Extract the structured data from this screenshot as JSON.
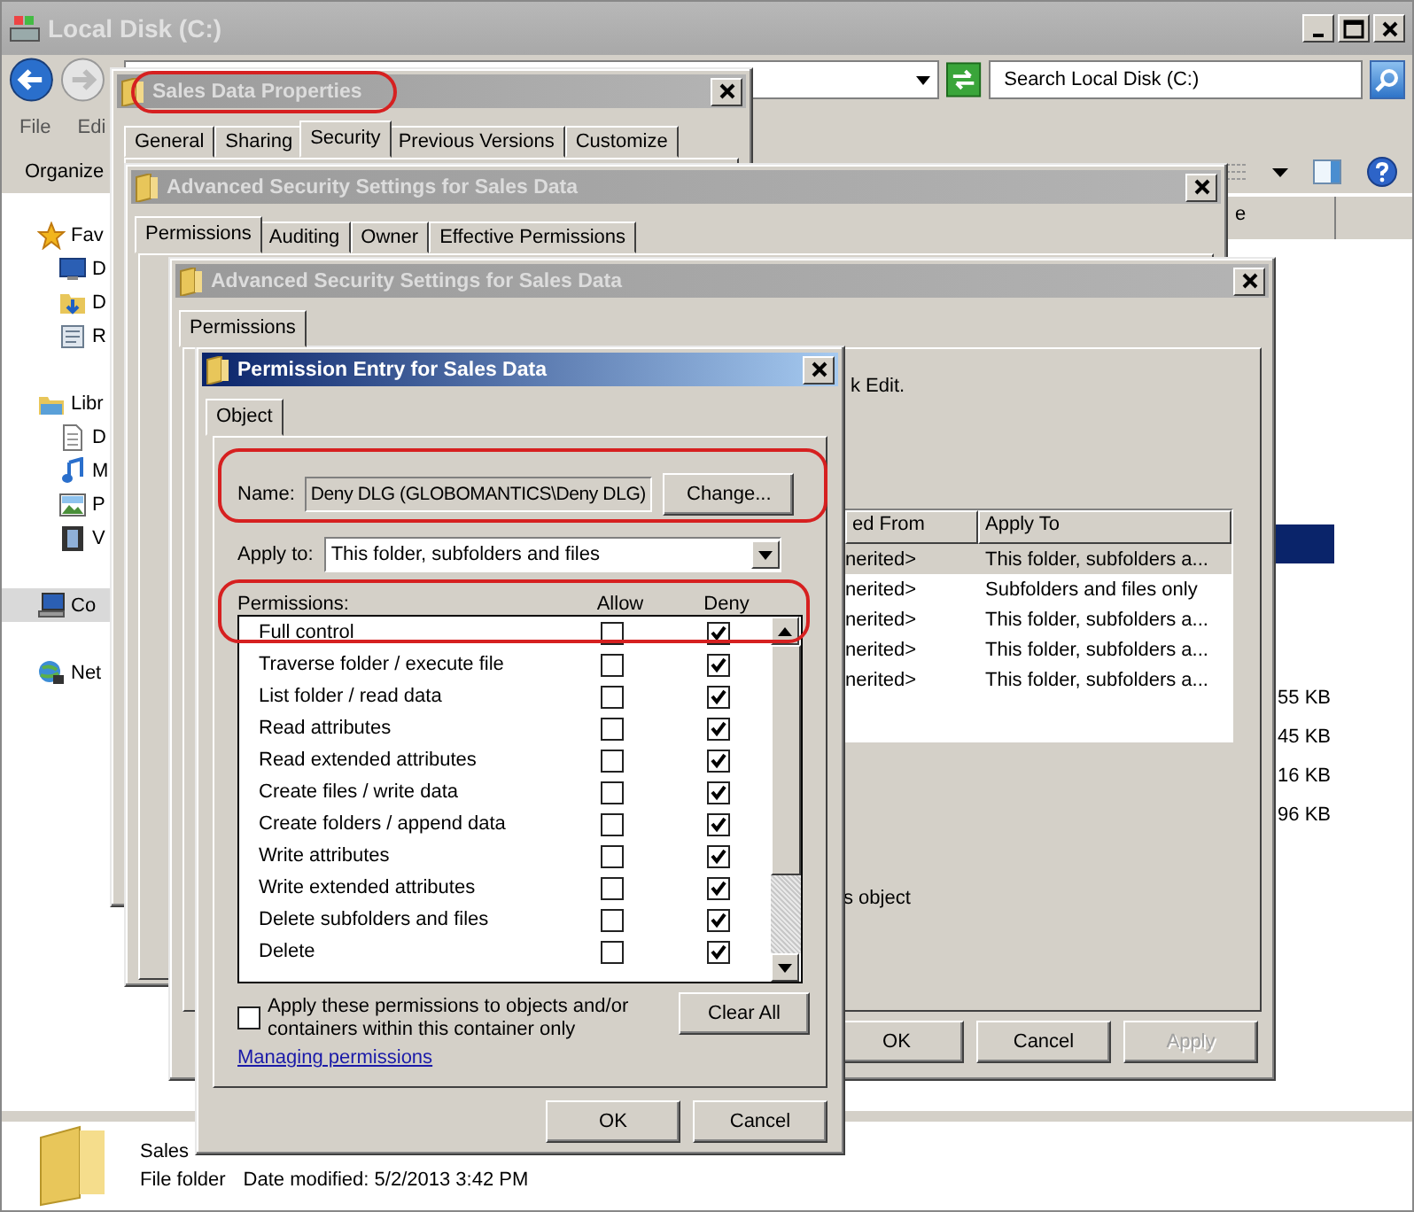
{
  "explorer": {
    "title": "Local Disk (C:)",
    "search": {
      "placeholder": "Search Local Disk (C:)"
    },
    "menu": [
      "File",
      "Edi"
    ],
    "organize": "Organize",
    "column_header": "e",
    "nav": [
      {
        "label": "Fav",
        "kind": "star",
        "selected": false,
        "children": [
          {
            "label": "D",
            "kind": "desktop",
            "selected": false
          },
          {
            "label": "D",
            "kind": "downloads",
            "selected": false
          },
          {
            "label": "R",
            "kind": "recent",
            "selected": false
          }
        ]
      },
      {
        "label": "Libr",
        "kind": "library",
        "selected": false,
        "children": [
          {
            "label": "D",
            "kind": "document",
            "selected": false
          },
          {
            "label": "M",
            "kind": "music",
            "selected": false
          },
          {
            "label": "P",
            "kind": "pictures",
            "selected": false
          },
          {
            "label": "V",
            "kind": "video",
            "selected": false
          }
        ]
      },
      {
        "label": "Co",
        "kind": "computer",
        "selected": true
      },
      {
        "label": "Net",
        "kind": "network",
        "selected": false
      }
    ],
    "files": [
      {
        "selected": true
      },
      {
        "size": "55 KB",
        "selected": false
      },
      {
        "size": "45 KB",
        "selected": false
      },
      {
        "size": "16 KB",
        "selected": false
      },
      {
        "size": "96 KB",
        "selected": false
      }
    ],
    "details": {
      "name": "Sales",
      "type": "File folder",
      "modified": "Date modified: 5/2/2013 3:42 PM"
    }
  },
  "properties": {
    "title": "Sales Data Properties",
    "highlighted": true,
    "tabs": [
      {
        "label": "General",
        "selected": false
      },
      {
        "label": "Sharing",
        "selected": false
      },
      {
        "label": "Security",
        "selected": true
      },
      {
        "label": "Previous Versions",
        "selected": false
      },
      {
        "label": "Customize",
        "selected": false
      }
    ]
  },
  "advanced_back": {
    "title": "Advanced Security Settings for Sales Data",
    "tabs": [
      {
        "label": "Permissions",
        "selected": true
      },
      {
        "label": "Auditing",
        "selected": false
      },
      {
        "label": "Owner",
        "selected": false
      },
      {
        "label": "Effective Permissions",
        "selected": false
      }
    ]
  },
  "advanced_front": {
    "title": "Advanced Security Settings for Sales Data",
    "tabs": [
      {
        "label": "Permissions",
        "selected": true
      }
    ],
    "hint": "k Edit.",
    "columns": [
      "ed From",
      "Apply To"
    ],
    "rows": [
      {
        "inherited_from": "nerited>",
        "apply_to": "This folder, subfolders a...",
        "selected": true
      },
      {
        "inherited_from": "nerited>",
        "apply_to": "Subfolders and files only",
        "selected": false
      },
      {
        "inherited_from": "nerited>",
        "apply_to": "This folder, subfolders a...",
        "selected": false
      },
      {
        "inherited_from": "nerited>",
        "apply_to": "This folder, subfolders a...",
        "selected": false
      },
      {
        "inherited_from": "nerited>",
        "apply_to": "This folder, subfolders a...",
        "selected": false
      }
    ],
    "note": "s object",
    "buttons": [
      {
        "label": "OK",
        "disabled": false
      },
      {
        "label": "Cancel",
        "disabled": false
      },
      {
        "label": "Apply",
        "disabled": true
      }
    ]
  },
  "permission_entry": {
    "title": "Permission Entry for Sales Data",
    "tabs": [
      {
        "label": "Object",
        "selected": true
      }
    ],
    "name_label": "Name:",
    "name_value": "Deny DLG (GLOBOMANTICS\\Deny DLG)",
    "name_highlighted": true,
    "change_button": "Change...",
    "apply_label": "Apply to:",
    "apply_value": "This folder, subfolders and files",
    "permissions_label": "Permissions:",
    "allow_header": "Allow",
    "deny_header": "Deny",
    "full_control_highlighted": true,
    "permissions": [
      {
        "name": "Full control",
        "allow": false,
        "deny": true
      },
      {
        "name": "Traverse folder / execute file",
        "allow": false,
        "deny": true
      },
      {
        "name": "List folder / read data",
        "allow": false,
        "deny": true
      },
      {
        "name": "Read attributes",
        "allow": false,
        "deny": true
      },
      {
        "name": "Read extended attributes",
        "allow": false,
        "deny": true
      },
      {
        "name": "Create files / write data",
        "allow": false,
        "deny": true
      },
      {
        "name": "Create folders / append data",
        "allow": false,
        "deny": true
      },
      {
        "name": "Write attributes",
        "allow": false,
        "deny": true
      },
      {
        "name": "Write extended attributes",
        "allow": false,
        "deny": true
      },
      {
        "name": "Delete subfolders and files",
        "allow": false,
        "deny": true
      },
      {
        "name": "Delete",
        "allow": false,
        "deny": true
      }
    ],
    "apply_inside": {
      "label": "Apply these permissions to objects and/or containers within this container only",
      "checked": false
    },
    "clear_all": "Clear All",
    "help_link": "Managing permissions",
    "buttons": [
      {
        "label": "OK",
        "disabled": false
      },
      {
        "label": "Cancel",
        "disabled": false
      }
    ]
  }
}
